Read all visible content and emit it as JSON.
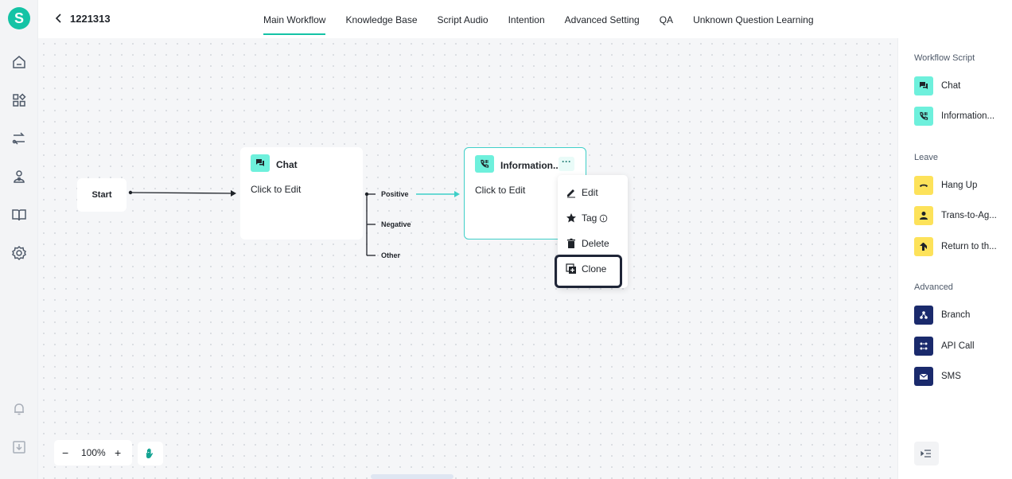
{
  "header": {
    "title": "1221313",
    "tabs": [
      {
        "label": "Main Workflow",
        "active": true
      },
      {
        "label": "Knowledge Base",
        "active": false
      },
      {
        "label": "Script Audio",
        "active": false
      },
      {
        "label": "Intention",
        "active": false
      },
      {
        "label": "Advanced Setting",
        "active": false
      },
      {
        "label": "QA",
        "active": false
      },
      {
        "label": "Unknown Question Learning",
        "active": false
      }
    ]
  },
  "sidebar": {
    "logo_letter": "S",
    "icons": [
      "home-icon",
      "apps-icon",
      "flow-icon",
      "agent-icon",
      "book-icon",
      "gear-icon",
      "bell-icon",
      "download-icon"
    ]
  },
  "canvas": {
    "start_label": "Start",
    "chat_node": {
      "name": "Chat",
      "subtitle": "Click to Edit"
    },
    "info_node": {
      "name": "Information...",
      "subtitle": "Click to Edit"
    },
    "branches": [
      "Positive",
      "Negative",
      "Other"
    ],
    "more_label": "···",
    "context_menu": {
      "edit": "Edit",
      "tag": "Tag",
      "delete": "Delete",
      "clone": "Clone"
    },
    "zoom": {
      "minus": "−",
      "value": "100%",
      "plus": "+"
    }
  },
  "panel": {
    "workflow_script_title": "Workflow Script",
    "workflow_items": [
      "Chat",
      "Information..."
    ],
    "leave_title": "Leave",
    "leave_items": [
      "Hang Up",
      "Trans-to-Ag...",
      "Return to th..."
    ],
    "advanced_title": "Advanced",
    "advanced_items": [
      "Branch",
      "API Call",
      "SMS"
    ]
  },
  "colors": {
    "accent": "#14c3a5",
    "teal_tile": "#6ef0dc",
    "yellow_tile": "#fde25a",
    "navy_tile": "#1a2a6c",
    "highlight_border": "#1f2537"
  }
}
